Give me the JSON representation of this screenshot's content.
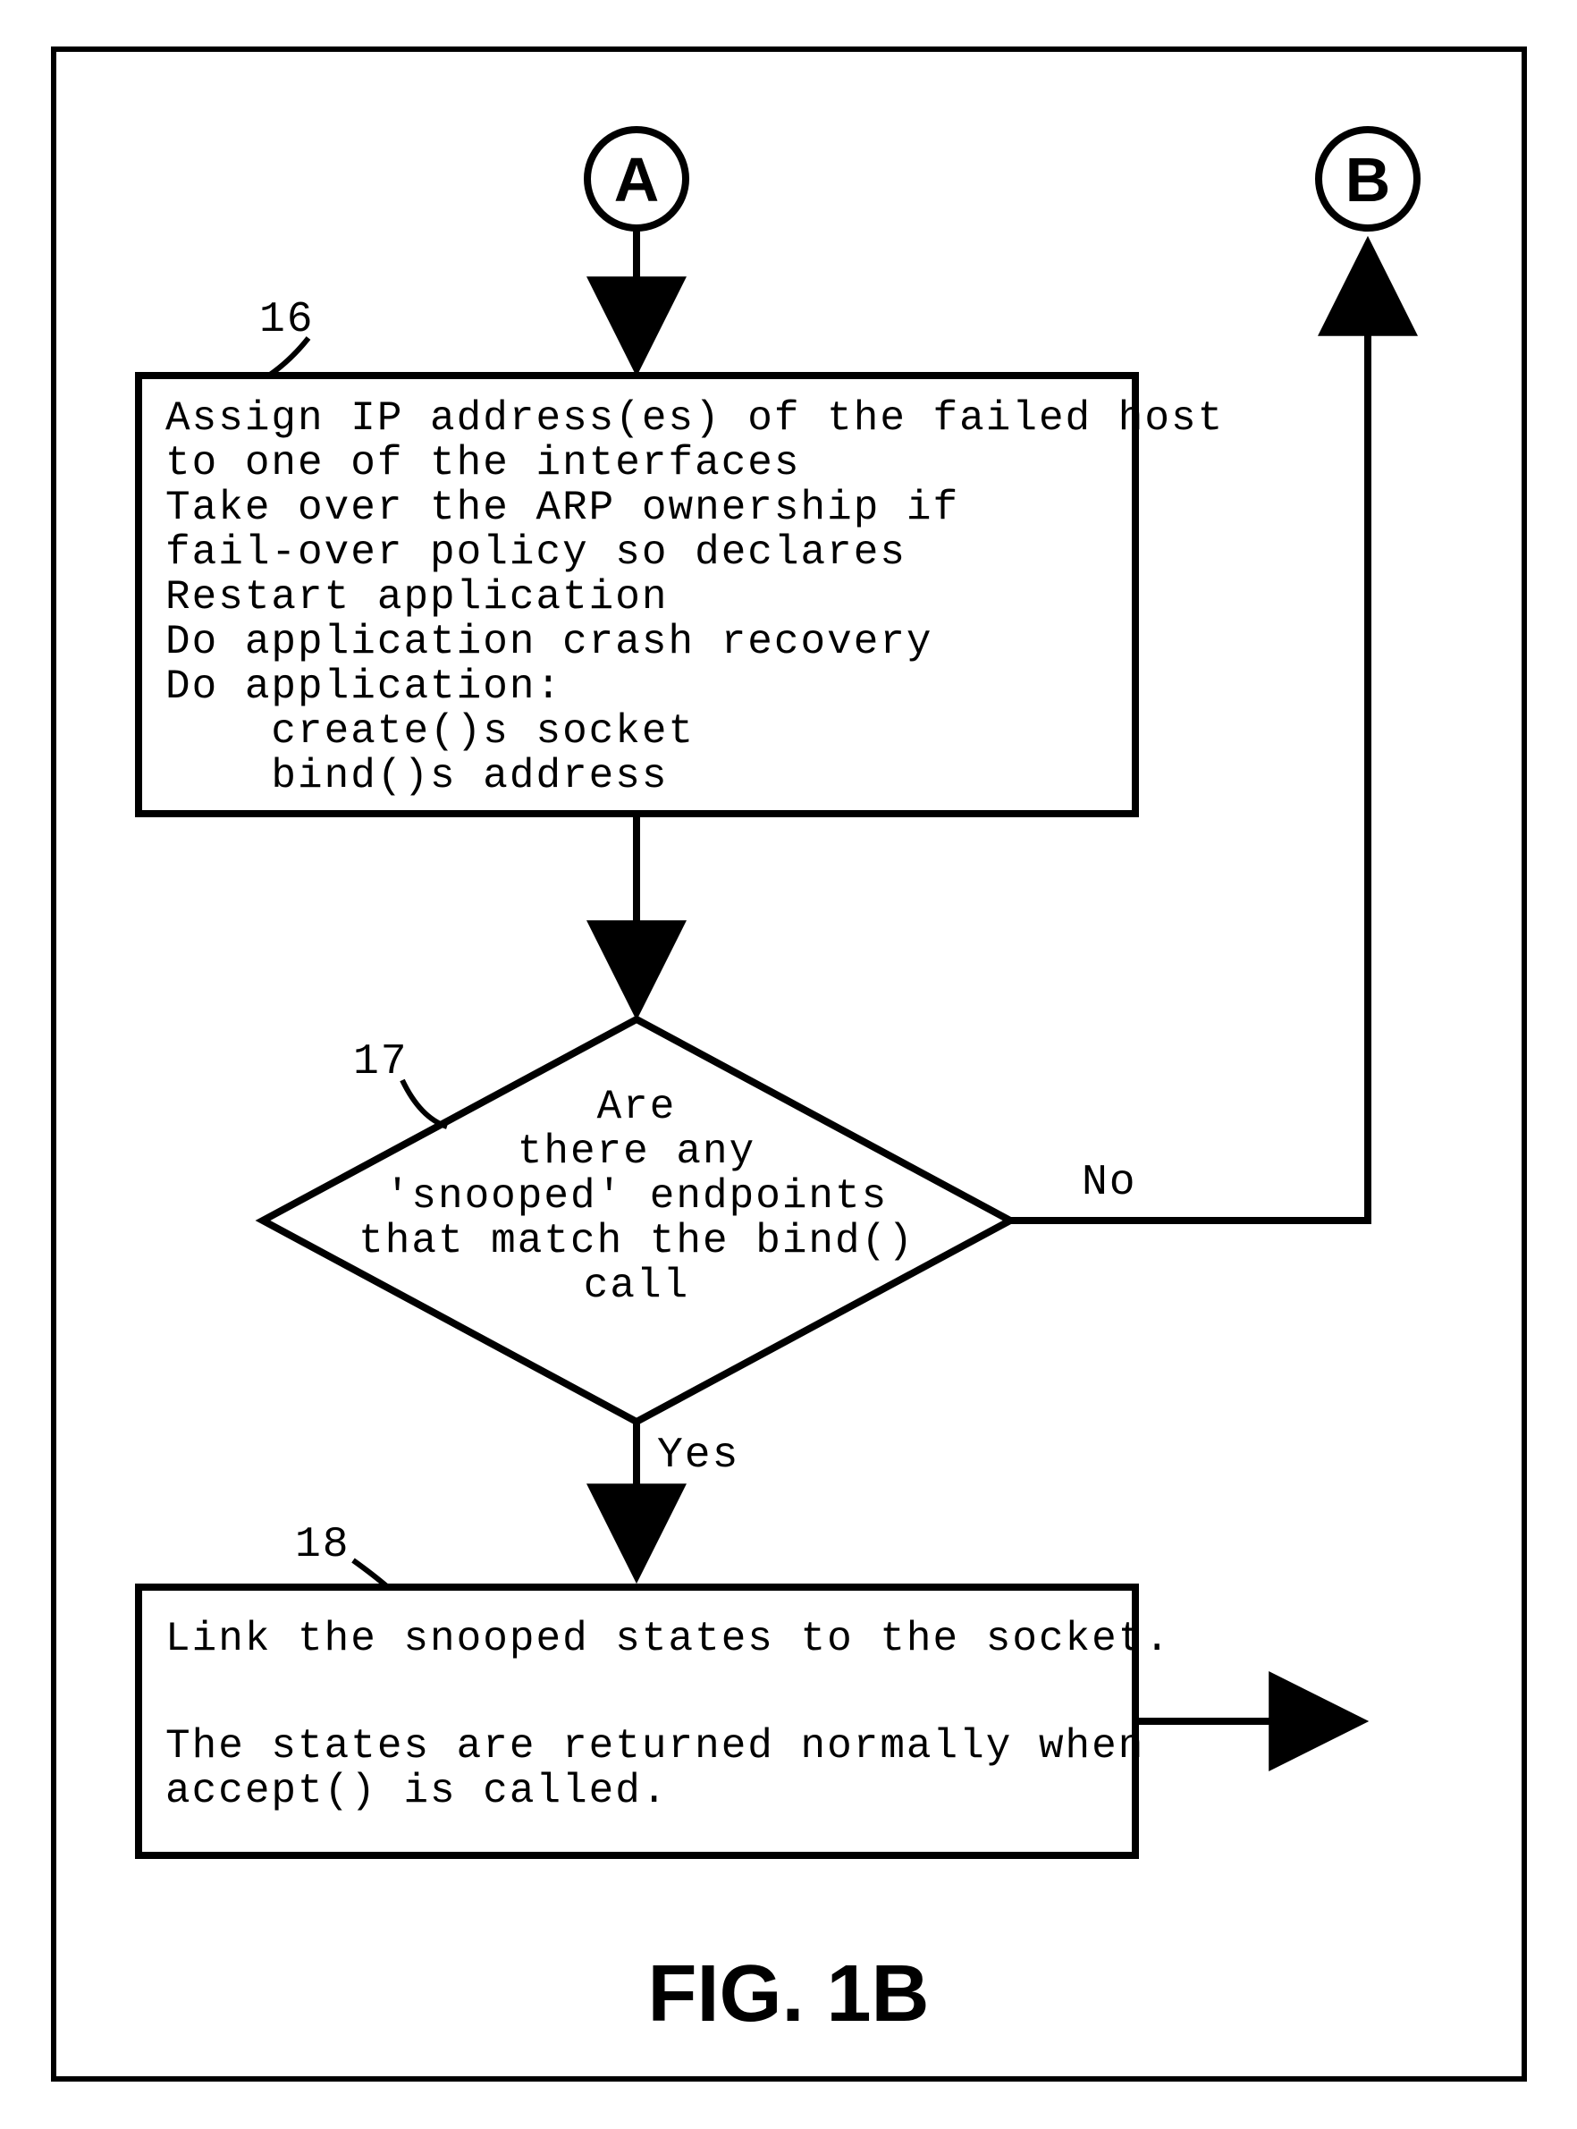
{
  "connectors": {
    "top_left": "A",
    "top_right": "B"
  },
  "labels": {
    "box16": "16",
    "dec17": "17",
    "box18": "18",
    "yes": "Yes",
    "no": "No"
  },
  "box16_lines": [
    "Assign IP address(es) of the failed host",
    "to one of the interfaces",
    "Take over the ARP ownership if",
    "fail-over policy so declares",
    "Restart application",
    "Do application crash recovery",
    "Do application:",
    "    create()s socket",
    "    bind()s address"
  ],
  "dec17_lines": [
    "Are",
    "there any",
    "'snooped' endpoints",
    "that match the bind()",
    "call"
  ],
  "box18_lines": [
    "Link the snooped states to the socket.",
    "",
    "The states are returned normally when",
    "accept() is called."
  ],
  "figure_caption": "FIG. 1B"
}
